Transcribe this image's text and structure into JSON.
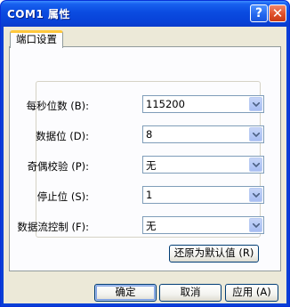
{
  "window": {
    "title": "COM1 属性",
    "help_glyph": "?",
    "close_glyph": "✕"
  },
  "tabs": [
    {
      "label": "端口设置"
    }
  ],
  "fields": [
    {
      "label": "每秒位数 (B):",
      "value": "115200"
    },
    {
      "label": "数据位 (D):",
      "value": "8"
    },
    {
      "label": "奇偶校验 (P):",
      "value": "无"
    },
    {
      "label": "停止位 (S):",
      "value": "1"
    },
    {
      "label": "数据流控制 (F):",
      "value": "无"
    }
  ],
  "restore_button": "还原为默认值 (R)",
  "footer": {
    "ok": "确定",
    "cancel": "取消",
    "apply": "应用 (A)"
  },
  "colors": {
    "titlebar": "#0a4be0",
    "client_bg": "#ece9d8",
    "tab_accent": "#ffc83c",
    "close_button": "#e0502a"
  },
  "icons": {
    "help": "question-icon",
    "close": "close-icon",
    "dropdown": "chevron-down-icon"
  }
}
